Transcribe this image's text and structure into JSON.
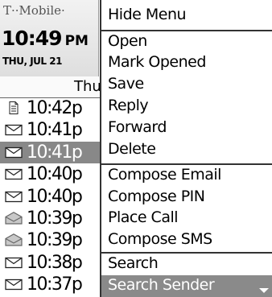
{
  "status": {
    "carrier": "T··Mobile·",
    "time": "10:49",
    "ampm": "PM",
    "date": "THU, JUL 21"
  },
  "list": {
    "day_header": "Thu",
    "messages": [
      {
        "icon": "document-icon",
        "time": "10:42p",
        "selected": false
      },
      {
        "icon": "envelope-icon",
        "time": "10:41p",
        "selected": false
      },
      {
        "icon": "envelope-icon",
        "time": "10:41p",
        "selected": true
      },
      {
        "icon": "envelope-icon",
        "time": "10:40p",
        "selected": false
      },
      {
        "icon": "envelope-icon",
        "time": "10:40p",
        "selected": false
      },
      {
        "icon": "open-envelope-icon",
        "time": "10:39p",
        "selected": false
      },
      {
        "icon": "open-envelope-icon",
        "time": "10:39p",
        "selected": false
      },
      {
        "icon": "envelope-icon",
        "time": "10:38p",
        "selected": false
      },
      {
        "icon": "envelope-icon",
        "time": "10:37p",
        "selected": false
      }
    ]
  },
  "menu": {
    "hide_menu": "Hide Menu",
    "open": "Open",
    "mark_opened": "Mark Opened",
    "save": "Save",
    "reply": "Reply",
    "forward": "Forward",
    "delete": "Delete",
    "compose_email": "Compose Email",
    "compose_pin": "Compose PIN",
    "place_call": "Place Call",
    "compose_sms": "Compose SMS",
    "search": "Search",
    "search_sender": "Search Sender",
    "selected_item": "search_sender",
    "scroll_icon": "scroll-down-icon"
  }
}
